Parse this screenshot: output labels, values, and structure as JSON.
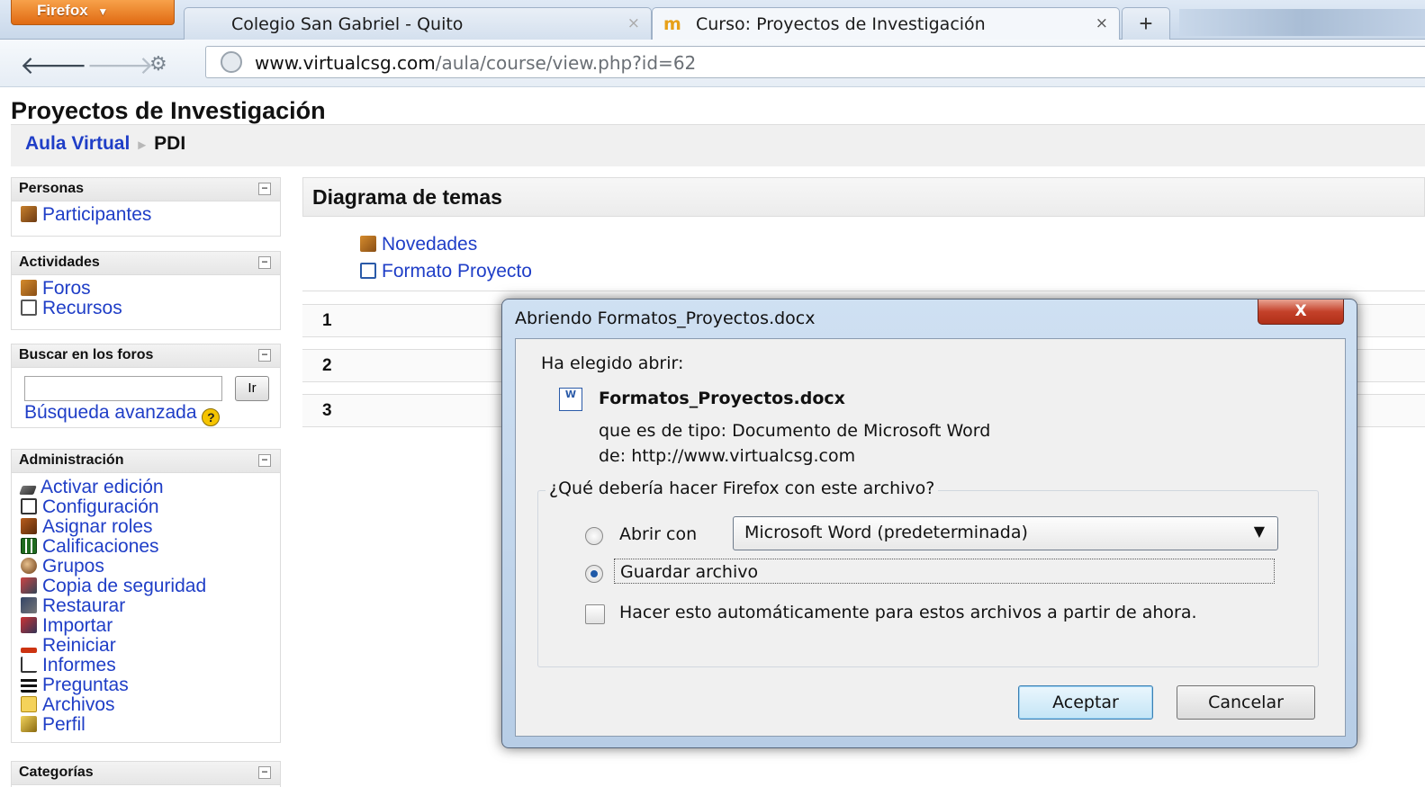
{
  "browser": {
    "app_button": "Firefox",
    "tabs": [
      {
        "label": "Colegio San Gabriel - Quito"
      },
      {
        "label": "Curso: Proyectos de Investigación"
      }
    ],
    "new_tab": "+",
    "url_domain": "www.virtualcsg.com",
    "url_path": "/aula/course/view.php?id=62"
  },
  "page": {
    "title": "Proyectos de Investigación",
    "breadcrumb": {
      "home": "Aula Virtual",
      "separator": "►",
      "current": "PDI"
    }
  },
  "sidebar": {
    "personas": {
      "title": "Personas",
      "items": [
        {
          "label": "Participantes",
          "icon": "participants-icon"
        }
      ]
    },
    "actividades": {
      "title": "Actividades",
      "items": [
        {
          "label": "Foros",
          "icon": "forum-icon"
        },
        {
          "label": "Recursos",
          "icon": "resource-icon"
        }
      ]
    },
    "buscar": {
      "title": "Buscar en los foros",
      "go_label": "Ir",
      "advanced": "Búsqueda avanzada",
      "help": "?"
    },
    "admin": {
      "title": "Administración",
      "items": [
        {
          "label": "Activar edición",
          "icon": "edit-icon"
        },
        {
          "label": "Configuración",
          "icon": "settings-icon"
        },
        {
          "label": "Asignar roles",
          "icon": "roles-icon"
        },
        {
          "label": "Calificaciones",
          "icon": "grades-icon"
        },
        {
          "label": "Grupos",
          "icon": "groups-icon"
        },
        {
          "label": "Copia de seguridad",
          "icon": "backup-icon"
        },
        {
          "label": "Restaurar",
          "icon": "restore-icon"
        },
        {
          "label": "Importar",
          "icon": "import-icon"
        },
        {
          "label": "Reiniciar",
          "icon": "reset-icon"
        },
        {
          "label": "Informes",
          "icon": "reports-icon"
        },
        {
          "label": "Preguntas",
          "icon": "questions-icon"
        },
        {
          "label": "Archivos",
          "icon": "folder-icon"
        },
        {
          "label": "Perfil",
          "icon": "profile-icon"
        }
      ]
    },
    "categorias": {
      "title": "Categorías"
    },
    "collapse_symbol": "−"
  },
  "main": {
    "topics_title": "Diagrama de temas",
    "section0_links": [
      {
        "label": "Novedades",
        "icon": "forum-icon"
      },
      {
        "label": "Formato Proyecto",
        "icon": "word-doc-icon"
      }
    ],
    "sections": [
      "1",
      "2",
      "3"
    ]
  },
  "dialog": {
    "title": "Abriendo Formatos_Proyectos.docx",
    "close": "X",
    "chosen": "Ha elegido abrir:",
    "word_icon_text": "W",
    "file_name": "Formatos_Proyectos.docx",
    "file_type": "que es de tipo:  Documento de Microsoft Word",
    "file_from": "de:  http://www.virtualcsg.com",
    "question": "¿Qué debería hacer Firefox con este archivo?",
    "open_with_label": "Abrir con",
    "open_with_value": "Microsoft Word (predeterminada)",
    "save_label": "Guardar archivo",
    "selected_option": "save",
    "auto_label": "Hacer esto automáticamente para estos archivos a partir de ahora.",
    "auto_checked": false,
    "accept": "Aceptar",
    "cancel": "Cancelar"
  }
}
